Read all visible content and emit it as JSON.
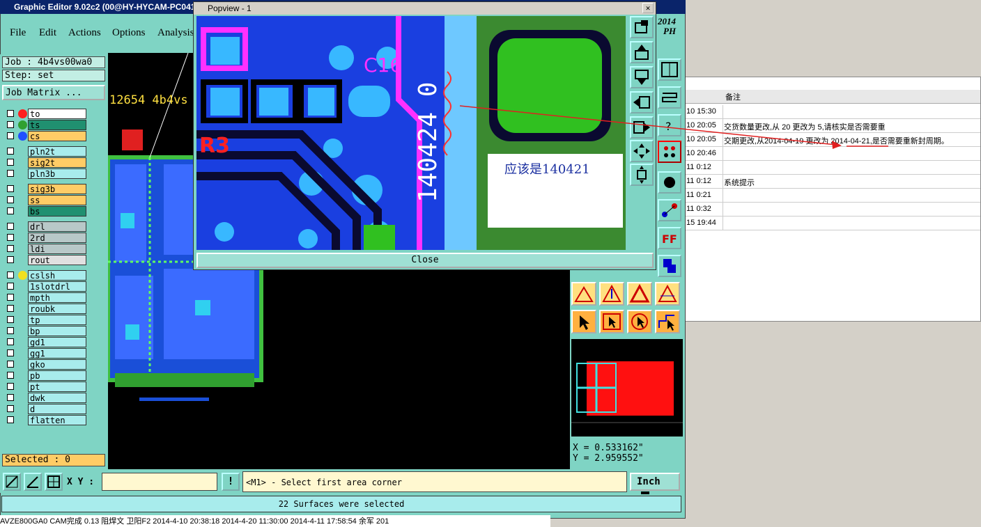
{
  "app": {
    "title": "Graphic Editor 9.02c2 (00@HY-HYCAM-PC041 -"
  },
  "menu": {
    "file": "File",
    "edit": "Edit",
    "actions": "Actions",
    "options": "Options",
    "analysis": "Analysis"
  },
  "job": {
    "label": "Job : 4b4vs00wa0",
    "step": "Step: set",
    "matrix_button": "Job Matrix ..."
  },
  "layers": [
    "to",
    "ts",
    "cs",
    "pln2t",
    "sig2t",
    "pln3b",
    "sig3b",
    "ss",
    "bs",
    "drl",
    "2rd",
    "ldi",
    "rout",
    "cslsh",
    "1slotdrl",
    "mpth",
    "roubk",
    "tp",
    "bp",
    "gd1",
    "gg1",
    "gko",
    "pb",
    "pt",
    "dwk",
    "d",
    "flatten"
  ],
  "colors": {
    "to": "#ff2020",
    "ts": "#20a040",
    "cs": "#2050ff",
    "accent": "#7fd4c4"
  },
  "selected": "Selected : 0",
  "canvas_text": {
    "job_serial": "12654 4b4vs"
  },
  "popview": {
    "title": "Popview - 1",
    "code": "140424 0",
    "ref1": "C16",
    "ref2": "R3",
    "note": "应该是140421",
    "close": "Close"
  },
  "cmd": {
    "xy_label": "X Y :",
    "xy_value": "",
    "prompt": "<M1> - Select first area corner",
    "unit": "Inch"
  },
  "coords": {
    "x": "X = 0.533162\"",
    "y": "Y = 2.959552\""
  },
  "status": "22 Surfaces were selected",
  "right_edge": {
    "year": "2014",
    "ph": "PH"
  },
  "bg_table": {
    "header": "备注",
    "rows": [
      {
        "t": "10 15:30",
        "v": ""
      },
      {
        "t": "10 20:05",
        "v": "交货数量更改,从 20 更改为 5,请核实是否需要重"
      },
      {
        "t": "10 20:05",
        "v": "交期更改,从2014-04-19 更改为 2014-04-21,是否需要重新封周期。"
      },
      {
        "t": "10 20:46",
        "v": ""
      },
      {
        "t": "11 0:12",
        "v": ""
      },
      {
        "t": "11 0:12",
        "v": "系统提示"
      },
      {
        "t": "11 0:21",
        "v": ""
      },
      {
        "t": "11 0:32",
        "v": ""
      },
      {
        "t": "15 19:44",
        "v": ""
      }
    ]
  },
  "bottom_row": "AVZE800GA0  CAM完成  0.13  阻焊文  卫阳F2  2014-4-10 20:38:18  2014-4-20 11:30:00  2014-4-11 17:58:54  余军  201"
}
